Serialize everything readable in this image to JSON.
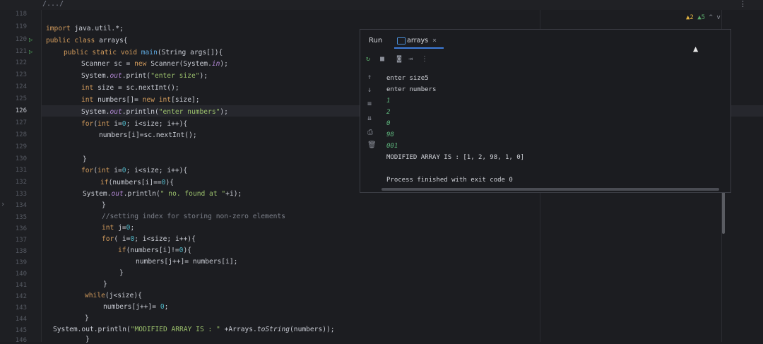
{
  "topbar": {
    "crumb": "/.../",
    "menu_icon": "more-vertical-icon"
  },
  "gutter": {
    "line_numbers": [
      "118",
      "119",
      "120",
      "121",
      "122",
      "123",
      "124",
      "125",
      "126",
      "127",
      "128",
      "129",
      "130",
      "131",
      "132",
      "133",
      "134",
      "135",
      "136",
      "137",
      "138",
      "139",
      "140",
      "141",
      "142",
      "143",
      "144",
      "145",
      "146"
    ],
    "current_line": "126"
  },
  "inspections": {
    "warnings": "▲2",
    "weak": "▲5",
    "nav": "^ v"
  },
  "code": {
    "l119": [
      "import ",
      "java.util.*;"
    ],
    "l120": [
      "public class ",
      "arrays{"
    ],
    "l121": [
      "public static void ",
      "main",
      "(String args[]){"
    ],
    "l122": [
      "Scanner sc = ",
      "new ",
      "Scanner(System.",
      "in",
      ");"
    ],
    "l123": [
      "System.",
      "out",
      ".print(",
      "\"enter size\"",
      ");"
    ],
    "l124": [
      "int ",
      "size = sc.nextInt();"
    ],
    "l125": [
      "int ",
      "numbers[]= ",
      "new int",
      "[size];"
    ],
    "l126": [
      "System.",
      "out",
      ".println(",
      "\"enter numbers\"",
      ");"
    ],
    "l127": [
      "for",
      "(",
      "int ",
      "i=",
      "0",
      "; i<size; i++){"
    ],
    "l128": [
      "numbers[i]=sc.nextInt();"
    ],
    "l130": [
      "}"
    ],
    "l131": [
      "for",
      "(",
      "int ",
      "i=",
      "0",
      "; i<size; i++){"
    ],
    "l132": [
      "if",
      "(numbers[i]==",
      "0",
      "){"
    ],
    "l133": [
      "System.",
      "out",
      ".println(",
      "\" no. found at \"",
      "+i);"
    ],
    "l134": [
      "}"
    ],
    "l135": [
      "//setting index for storing non-zero elements"
    ],
    "l136": [
      "int ",
      "j=",
      "0",
      ";"
    ],
    "l137": [
      "for",
      "( i=",
      "0",
      "; i<size; i++){"
    ],
    "l138": [
      "if",
      "(numbers[i]!=",
      "0",
      "){"
    ],
    "l139": [
      "numbers[j++]= numbers[i];"
    ],
    "l140": [
      "}"
    ],
    "l141": [
      "}"
    ],
    "l142": [
      "while",
      "(j<size){"
    ],
    "l143": [
      "numbers[j++]= ",
      "0",
      ";"
    ],
    "l144": [
      "}"
    ],
    "l145": [
      "System.out.println(",
      "\"MODIFIED ARRAY IS : \"",
      " +Arrays.",
      "toString",
      "(numbers));"
    ],
    "l146": [
      "}"
    ]
  },
  "run_panel": {
    "title": "Run",
    "tab_label": "arrays",
    "tab_close": "×",
    "toolbar_icons": [
      "rerun-icon",
      "stop-icon",
      "camera-icon",
      "exit-icon",
      "more-icon"
    ],
    "side_icons": [
      "up-arrow-icon",
      "down-arrow-icon",
      "soft-wrap-icon",
      "scroll-end-icon",
      "print-icon",
      "trash-icon"
    ],
    "console": [
      {
        "text": "enter size",
        "input": "5"
      },
      {
        "text": "enter numbers",
        "input": ""
      },
      {
        "text": "",
        "input": "1"
      },
      {
        "text": "",
        "input": "2"
      },
      {
        "text": "",
        "input": "0"
      },
      {
        "text": "",
        "input": "98"
      },
      {
        "text": "",
        "input": "001"
      },
      {
        "text": "MODIFIED ARRAY IS : [1, 2, 98, 1, 0]",
        "input": ""
      },
      {
        "text": "",
        "input": ""
      },
      {
        "text": "Process finished with exit code 0",
        "input": ""
      }
    ]
  },
  "colors": {
    "keyword": "#d29b5c",
    "string": "#9bc06c",
    "field": "#b388d6",
    "run_green": "#59a869",
    "accent": "#3d7bd9"
  }
}
